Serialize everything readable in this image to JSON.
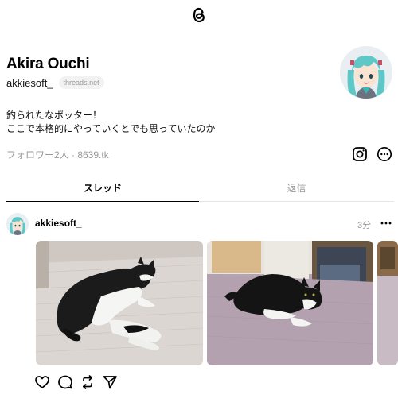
{
  "profile": {
    "display_name": "Akira Ouchi",
    "handle": "akkiesoft_",
    "domain_badge": "threads.net",
    "bio_line1": "釣られたなポッター！",
    "bio_line2": "ここで本格的にやっていくとでも思っていたのか",
    "followers": "フォロワー2人 · 8639.tk"
  },
  "tabs": [
    {
      "label": "スレッド",
      "active": true
    },
    {
      "label": "返信",
      "active": false
    }
  ],
  "post": {
    "username": "akkiesoft_",
    "time": "3分"
  },
  "icons": {
    "logo": "threads-logo-icon",
    "instagram": "instagram-icon",
    "more": "more-circle-icon",
    "like": "heart-icon",
    "reply": "comment-icon",
    "repost": "repost-icon",
    "share": "send-icon"
  },
  "colors": {
    "muted": "#999999",
    "divider": "#e5e5e5",
    "badge_bg": "#f2f2f2"
  }
}
